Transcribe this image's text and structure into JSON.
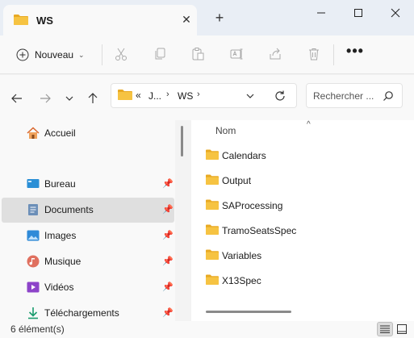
{
  "tab": {
    "title": "WS",
    "close_label": "✕",
    "add_label": "+"
  },
  "window": {
    "minimize": "minimize",
    "maximize": "maximize",
    "close": "close"
  },
  "toolbar": {
    "new_label": "Nouveau",
    "more_label": "•••",
    "icons": [
      "cut-icon",
      "copy-icon",
      "paste-icon",
      "rename-icon",
      "share-icon",
      "delete-icon"
    ]
  },
  "address": {
    "overflow": "«",
    "segments": [
      "J...",
      "WS"
    ],
    "separator": "›",
    "refresh_icon": "refresh-icon"
  },
  "search": {
    "placeholder": "Rechercher ..."
  },
  "nav": {
    "items": [
      {
        "label": "Accueil",
        "icon": "home-icon",
        "pinned": false,
        "selected": false
      },
      {
        "label": "Bureau",
        "icon": "desktop-icon",
        "pinned": true,
        "selected": false
      },
      {
        "label": "Documents",
        "icon": "documents-icon",
        "pinned": true,
        "selected": true
      },
      {
        "label": "Images",
        "icon": "pictures-icon",
        "pinned": true,
        "selected": false
      },
      {
        "label": "Musique",
        "icon": "music-icon",
        "pinned": true,
        "selected": false
      },
      {
        "label": "Vidéos",
        "icon": "videos-icon",
        "pinned": true,
        "selected": false
      },
      {
        "label": "Téléchargements",
        "icon": "downloads-icon",
        "pinned": true,
        "selected": false
      }
    ]
  },
  "content": {
    "column_header": "Nom",
    "sort_indicator": "^",
    "files": [
      "Calendars",
      "Output",
      "SAProcessing",
      "TramoSeatsSpec",
      "Variables",
      "X13Spec"
    ]
  },
  "status": {
    "count": "6 élément(s)"
  },
  "colors": {
    "folder": "#f6c342",
    "folder_dark": "#e8a923",
    "selected_bg": "#dfdfdf",
    "title_bg": "#e9eef5"
  }
}
